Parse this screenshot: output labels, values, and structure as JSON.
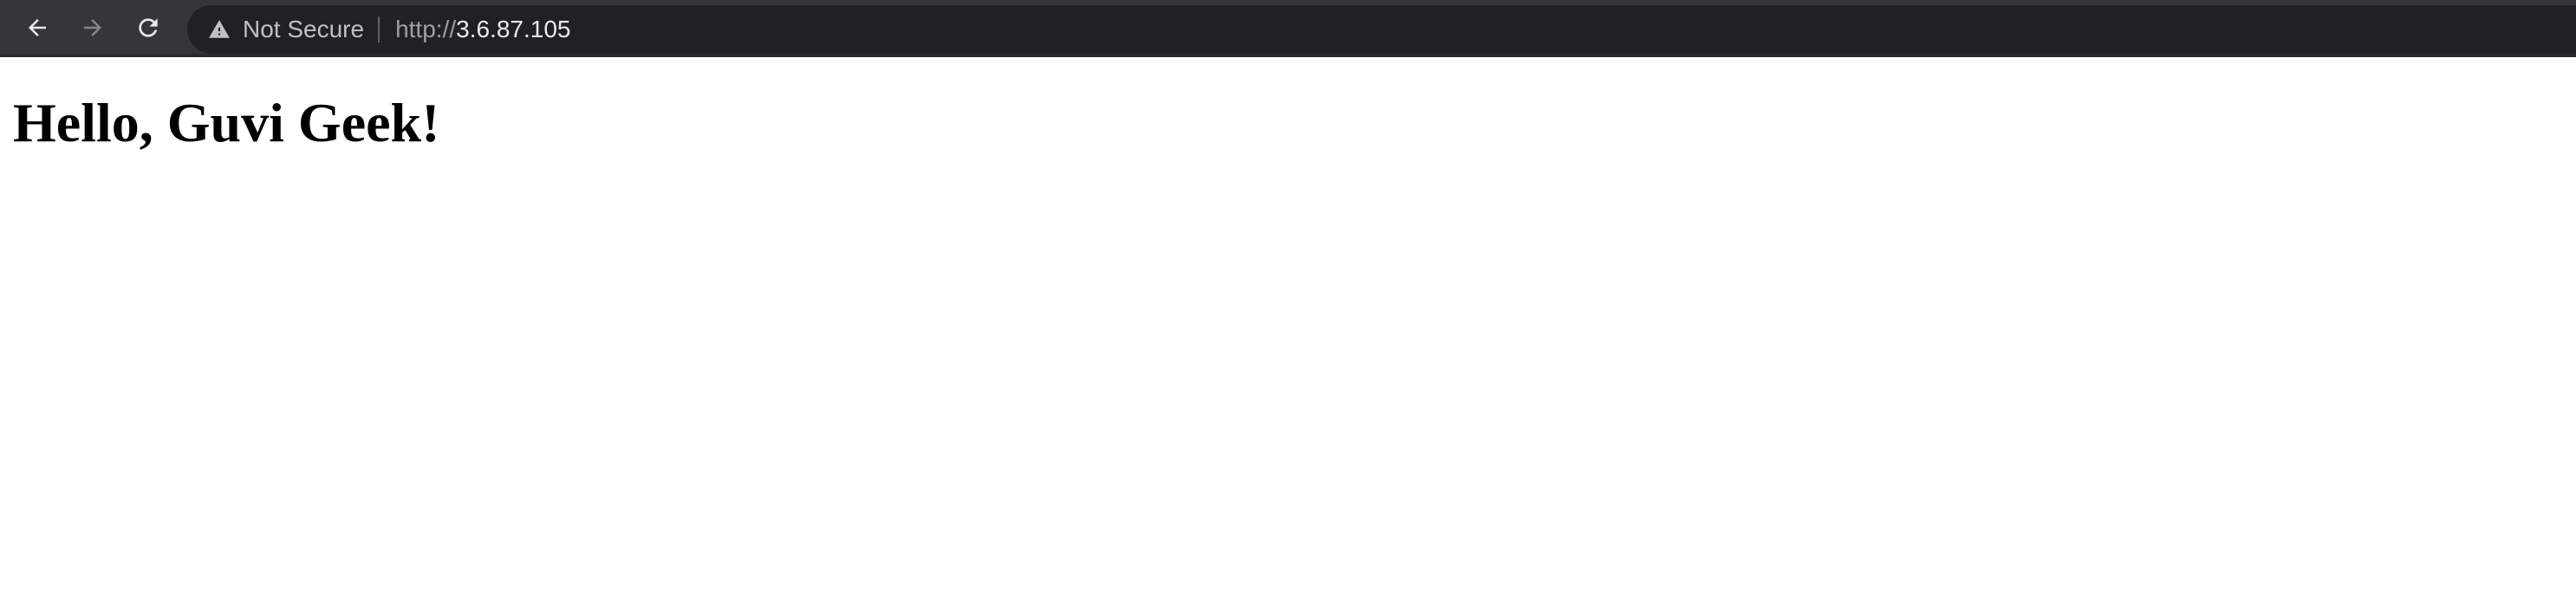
{
  "browser": {
    "nav": {
      "back_icon": "arrow-left-icon",
      "forward_icon": "arrow-right-icon",
      "reload_icon": "reload-icon"
    },
    "omnibox": {
      "security_icon": "warning-triangle-icon",
      "security_label": "Not Secure",
      "url_scheme": "http://",
      "url_host": "3.6.87.105"
    },
    "colors": {
      "toolbar_bg": "#35363a",
      "omnibox_bg": "#202124",
      "icon_active": "#e8eaed",
      "icon_disabled": "#80868b"
    }
  },
  "page": {
    "heading": "Hello, Guvi Geek!"
  }
}
